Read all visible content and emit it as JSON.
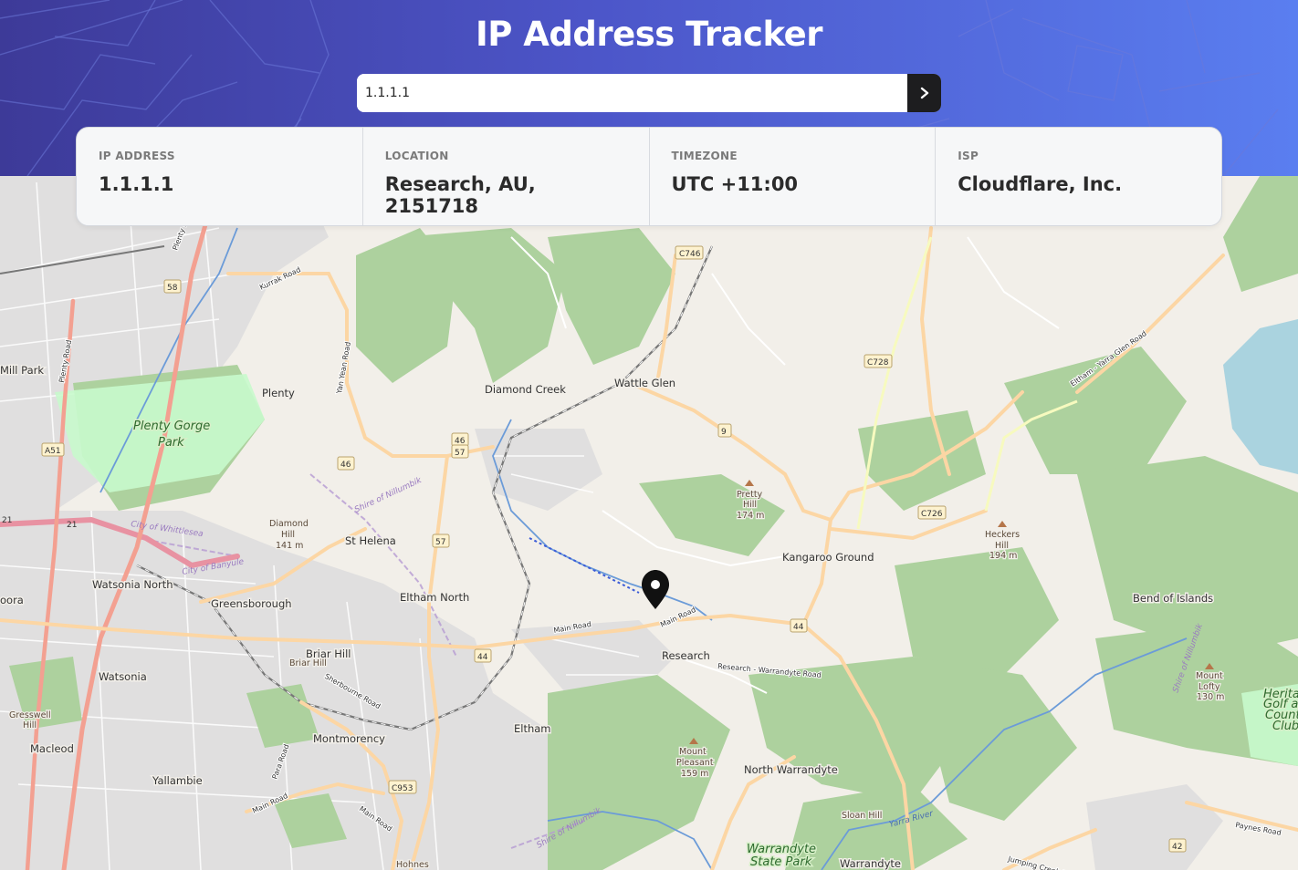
{
  "header": {
    "title": "IP Address Tracker",
    "search": {
      "value": "1.1.1.1",
      "button": "submit-arrow"
    }
  },
  "info": [
    {
      "label": "IP ADDRESS",
      "value": "1.1.1.1"
    },
    {
      "label": "LOCATION",
      "value": "Research, AU, 2151718"
    },
    {
      "label": "TIMEZONE",
      "value": "UTC +11:00"
    },
    {
      "label": "ISP",
      "value": "Cloudflare, Inc."
    }
  ],
  "map": {
    "marker_location": "Research",
    "places": [
      "Mill Park",
      "Plenty",
      "Diamond Creek",
      "Wattle Glen",
      "St Helena",
      "Watsonia North",
      "Greensborough",
      "Eltham North",
      "Kangaroo Ground",
      "Bend of Islands",
      "Research",
      "Briar Hill",
      "Watsonia",
      "Eltham",
      "Montmorency",
      "Macleod",
      "Yallambie",
      "North Warrandyte",
      "Warrandyte",
      "oora"
    ],
    "parks": [
      "Plenty Gorge",
      "Park",
      "Warrandyte",
      "State Park"
    ],
    "peaks": [
      [
        "Diamond",
        "Hill",
        "141 m"
      ],
      [
        "Pretty",
        "Hill",
        "174 m"
      ],
      [
        "Heckers",
        "Hill",
        "194 m"
      ],
      [
        "Mount",
        "Pleasant",
        "159 m"
      ],
      [
        "Mount",
        "Lofty",
        "130 m"
      ],
      [
        "Briar Hill"
      ],
      [
        "Sloan Hill"
      ],
      [
        "Gresswell",
        "Hill"
      ]
    ],
    "roads": [
      "Kurrak Road",
      "Yan Yean Road",
      "Plenty Road",
      "Plenty Rd",
      "Main Road",
      "Main Road",
      "Research - Warrandyte Road",
      "Sherbourne Road",
      "Para Road",
      "Main Road",
      "Main Road",
      "Eltham - Yarra Glen Road",
      "Paynes Road",
      "Jumping Creek Road"
    ],
    "shields": [
      "C746",
      "58",
      "C728",
      "9",
      "46",
      "46",
      "57",
      "57",
      "C726",
      "A51",
      "21",
      "21",
      "44",
      "44",
      "C953",
      "42"
    ],
    "boundaries": [
      "Shire of Nillumbik",
      "City of Whittlesea",
      "City of Banyule",
      "Shire of Nillumbik",
      "Shire of Nillumbik"
    ],
    "water": [
      "Yarra River"
    ],
    "misc": [
      "Heritage",
      "Golf and",
      "Country",
      "Club",
      "Hohnes"
    ]
  }
}
